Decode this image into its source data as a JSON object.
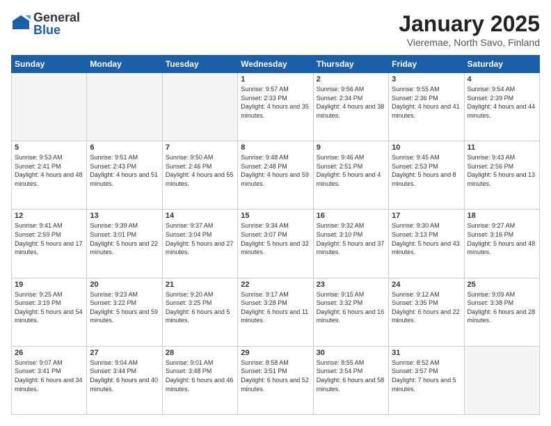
{
  "header": {
    "logo": {
      "general": "General",
      "blue": "Blue"
    },
    "title": "January 2025",
    "location": "Vieremae, North Savo, Finland"
  },
  "weekdays": [
    "Sunday",
    "Monday",
    "Tuesday",
    "Wednesday",
    "Thursday",
    "Friday",
    "Saturday"
  ],
  "weeks": [
    [
      {
        "day": "",
        "empty": true
      },
      {
        "day": "",
        "empty": true
      },
      {
        "day": "",
        "empty": true
      },
      {
        "day": "1",
        "sunrise": "9:57 AM",
        "sunset": "2:33 PM",
        "daylight": "4 hours and 35 minutes."
      },
      {
        "day": "2",
        "sunrise": "9:56 AM",
        "sunset": "2:34 PM",
        "daylight": "4 hours and 38 minutes."
      },
      {
        "day": "3",
        "sunrise": "9:55 AM",
        "sunset": "2:36 PM",
        "daylight": "4 hours and 41 minutes."
      },
      {
        "day": "4",
        "sunrise": "9:54 AM",
        "sunset": "2:39 PM",
        "daylight": "4 hours and 44 minutes."
      }
    ],
    [
      {
        "day": "5",
        "sunrise": "9:53 AM",
        "sunset": "2:41 PM",
        "daylight": "4 hours and 48 minutes."
      },
      {
        "day": "6",
        "sunrise": "9:51 AM",
        "sunset": "2:43 PM",
        "daylight": "4 hours and 51 minutes."
      },
      {
        "day": "7",
        "sunrise": "9:50 AM",
        "sunset": "2:46 PM",
        "daylight": "4 hours and 55 minutes."
      },
      {
        "day": "8",
        "sunrise": "9:48 AM",
        "sunset": "2:48 PM",
        "daylight": "4 hours and 59 minutes."
      },
      {
        "day": "9",
        "sunrise": "9:46 AM",
        "sunset": "2:51 PM",
        "daylight": "5 hours and 4 minutes."
      },
      {
        "day": "10",
        "sunrise": "9:45 AM",
        "sunset": "2:53 PM",
        "daylight": "5 hours and 8 minutes."
      },
      {
        "day": "11",
        "sunrise": "9:43 AM",
        "sunset": "2:56 PM",
        "daylight": "5 hours and 13 minutes."
      }
    ],
    [
      {
        "day": "12",
        "sunrise": "9:41 AM",
        "sunset": "2:59 PM",
        "daylight": "5 hours and 17 minutes."
      },
      {
        "day": "13",
        "sunrise": "9:39 AM",
        "sunset": "3:01 PM",
        "daylight": "5 hours and 22 minutes."
      },
      {
        "day": "14",
        "sunrise": "9:37 AM",
        "sunset": "3:04 PM",
        "daylight": "5 hours and 27 minutes."
      },
      {
        "day": "15",
        "sunrise": "9:34 AM",
        "sunset": "3:07 PM",
        "daylight": "5 hours and 32 minutes."
      },
      {
        "day": "16",
        "sunrise": "9:32 AM",
        "sunset": "3:10 PM",
        "daylight": "5 hours and 37 minutes."
      },
      {
        "day": "17",
        "sunrise": "9:30 AM",
        "sunset": "3:13 PM",
        "daylight": "5 hours and 43 minutes."
      },
      {
        "day": "18",
        "sunrise": "9:27 AM",
        "sunset": "3:16 PM",
        "daylight": "5 hours and 48 minutes."
      }
    ],
    [
      {
        "day": "19",
        "sunrise": "9:25 AM",
        "sunset": "3:19 PM",
        "daylight": "5 hours and 54 minutes."
      },
      {
        "day": "20",
        "sunrise": "9:23 AM",
        "sunset": "3:22 PM",
        "daylight": "5 hours and 59 minutes."
      },
      {
        "day": "21",
        "sunrise": "9:20 AM",
        "sunset": "3:25 PM",
        "daylight": "6 hours and 5 minutes."
      },
      {
        "day": "22",
        "sunrise": "9:17 AM",
        "sunset": "3:28 PM",
        "daylight": "6 hours and 11 minutes."
      },
      {
        "day": "23",
        "sunrise": "9:15 AM",
        "sunset": "3:32 PM",
        "daylight": "6 hours and 16 minutes."
      },
      {
        "day": "24",
        "sunrise": "9:12 AM",
        "sunset": "3:35 PM",
        "daylight": "6 hours and 22 minutes."
      },
      {
        "day": "25",
        "sunrise": "9:09 AM",
        "sunset": "3:38 PM",
        "daylight": "6 hours and 28 minutes."
      }
    ],
    [
      {
        "day": "26",
        "sunrise": "9:07 AM",
        "sunset": "3:41 PM",
        "daylight": "6 hours and 34 minutes."
      },
      {
        "day": "27",
        "sunrise": "9:04 AM",
        "sunset": "3:44 PM",
        "daylight": "6 hours and 40 minutes."
      },
      {
        "day": "28",
        "sunrise": "9:01 AM",
        "sunset": "3:48 PM",
        "daylight": "6 hours and 46 minutes."
      },
      {
        "day": "29",
        "sunrise": "8:58 AM",
        "sunset": "3:51 PM",
        "daylight": "6 hours and 52 minutes."
      },
      {
        "day": "30",
        "sunrise": "8:55 AM",
        "sunset": "3:54 PM",
        "daylight": "6 hours and 58 minutes."
      },
      {
        "day": "31",
        "sunrise": "8:52 AM",
        "sunset": "3:57 PM",
        "daylight": "7 hours and 5 minutes."
      },
      {
        "day": "",
        "empty": true
      }
    ]
  ]
}
